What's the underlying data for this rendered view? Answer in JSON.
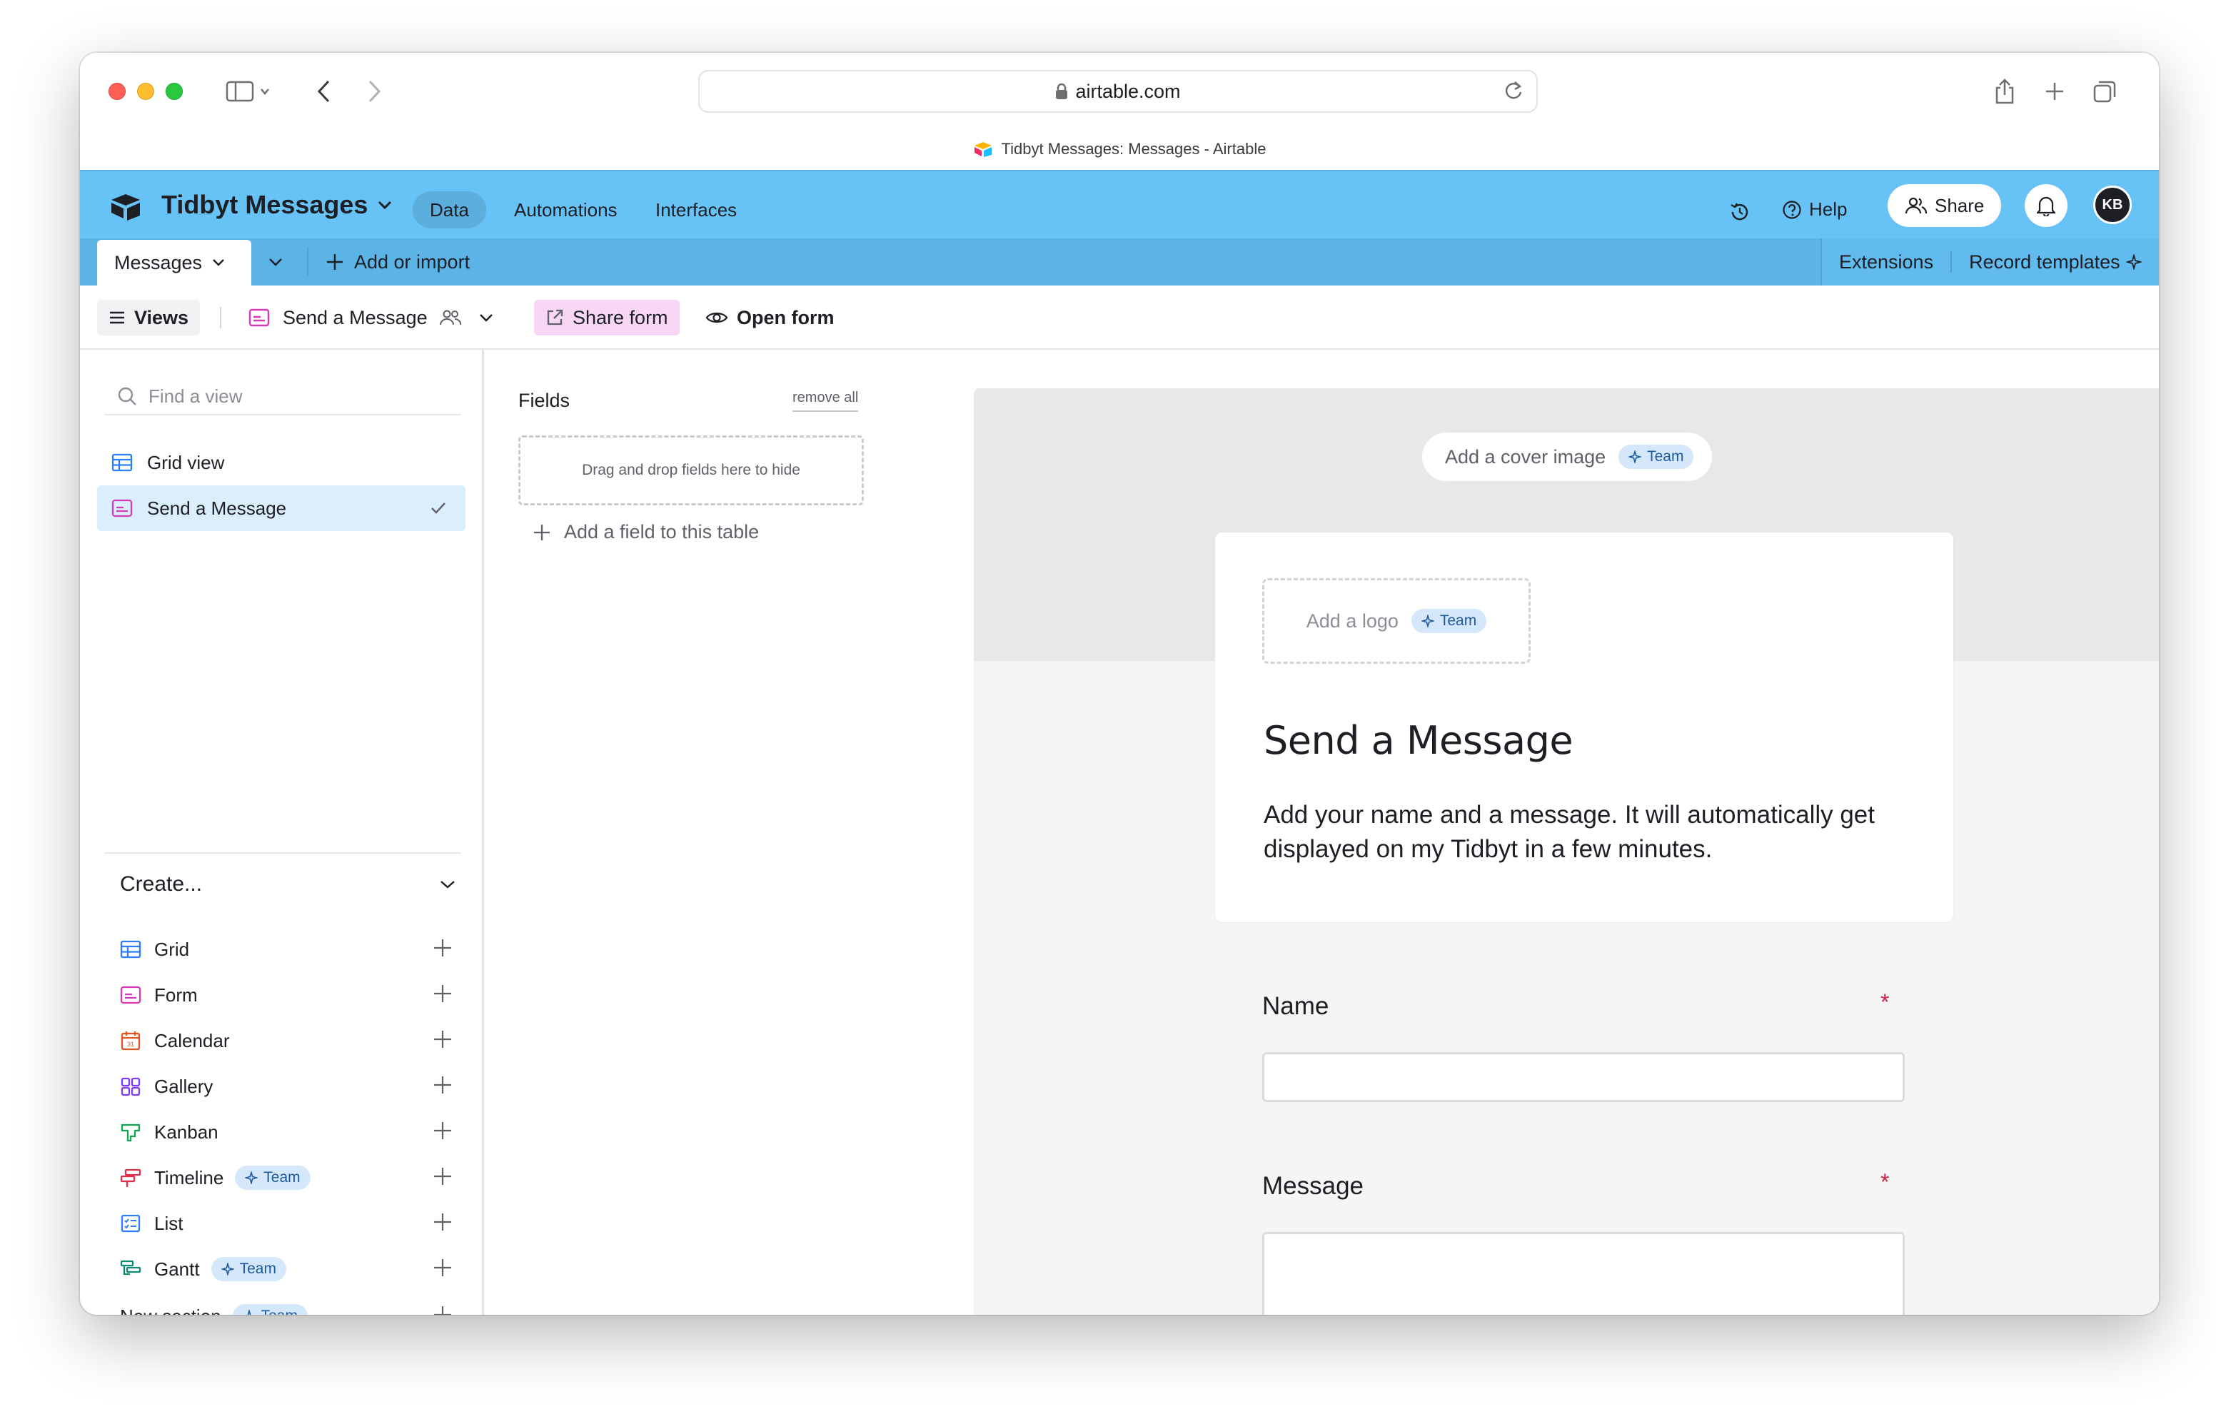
{
  "browser": {
    "url": "airtable.com",
    "tab_title": "Tidbyt Messages: Messages - Airtable"
  },
  "header": {
    "base_name": "Tidbyt Messages",
    "nav": [
      "Data",
      "Automations",
      "Interfaces"
    ],
    "active_nav": "Data",
    "help_label": "Help",
    "share_label": "Share",
    "avatar_initials": "KB",
    "accent_color": "#67c2f5"
  },
  "tables_bar": {
    "current_table": "Messages",
    "add_import_label": "Add or import",
    "extensions_label": "Extensions",
    "record_templates_label": "Record templates"
  },
  "view_bar": {
    "views_label": "Views",
    "current_view": "Send a Message",
    "share_form_label": "Share form",
    "open_form_label": "Open form"
  },
  "sidebar": {
    "find_placeholder": "Find a view",
    "views": [
      {
        "label": "Grid view",
        "icon": "grid-icon",
        "selected": false
      },
      {
        "label": "Send a Message",
        "icon": "form-icon",
        "selected": true
      }
    ],
    "create_label": "Create...",
    "create_items": [
      {
        "label": "Grid",
        "icon": "grid-icon",
        "badge": ""
      },
      {
        "label": "Form",
        "icon": "form-icon",
        "badge": ""
      },
      {
        "label": "Calendar",
        "icon": "calendar-icon",
        "badge": ""
      },
      {
        "label": "Gallery",
        "icon": "gallery-icon",
        "badge": ""
      },
      {
        "label": "Kanban",
        "icon": "kanban-icon",
        "badge": ""
      },
      {
        "label": "Timeline",
        "icon": "timeline-icon",
        "badge": "Team"
      },
      {
        "label": "List",
        "icon": "list-icon",
        "badge": ""
      },
      {
        "label": "Gantt",
        "icon": "gantt-icon",
        "badge": "Team"
      },
      {
        "label": "New section",
        "icon": "",
        "badge": "Team"
      }
    ]
  },
  "fields_panel": {
    "title": "Fields",
    "remove_all_label": "remove all",
    "drop_hint": "Drag and drop fields here to hide",
    "add_field_label": "Add a field to this table"
  },
  "form": {
    "cover_label": "Add a cover image",
    "cover_badge": "Team",
    "logo_label": "Add a logo",
    "logo_badge": "Team",
    "title": "Send a Message",
    "description": "Add your name and a message. It will automatically get displayed on my Tidbyt in a few minutes.",
    "fields": [
      {
        "label": "Name",
        "required": true,
        "value": ""
      },
      {
        "label": "Message",
        "required": true,
        "value": ""
      }
    ],
    "required_mark": "*"
  }
}
